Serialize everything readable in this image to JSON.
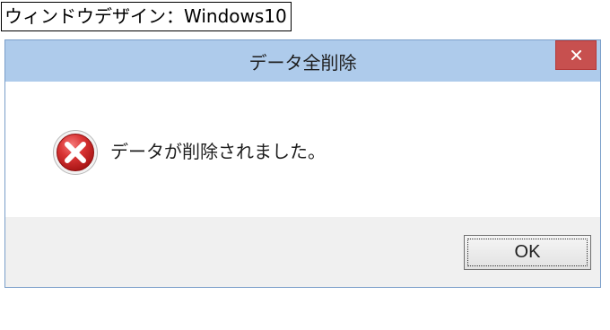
{
  "caption": "ウィンドウデザイン：Windows10",
  "dialog": {
    "title": "データ全削除",
    "message": "データが削除されました。",
    "ok_label": "OK",
    "close_symbol": "×",
    "icon": "error-icon"
  },
  "colors": {
    "titlebar": "#aecbeb",
    "close_button": "#c7504f",
    "footer": "#f0f0f0",
    "error_red": "#d22b2b"
  }
}
